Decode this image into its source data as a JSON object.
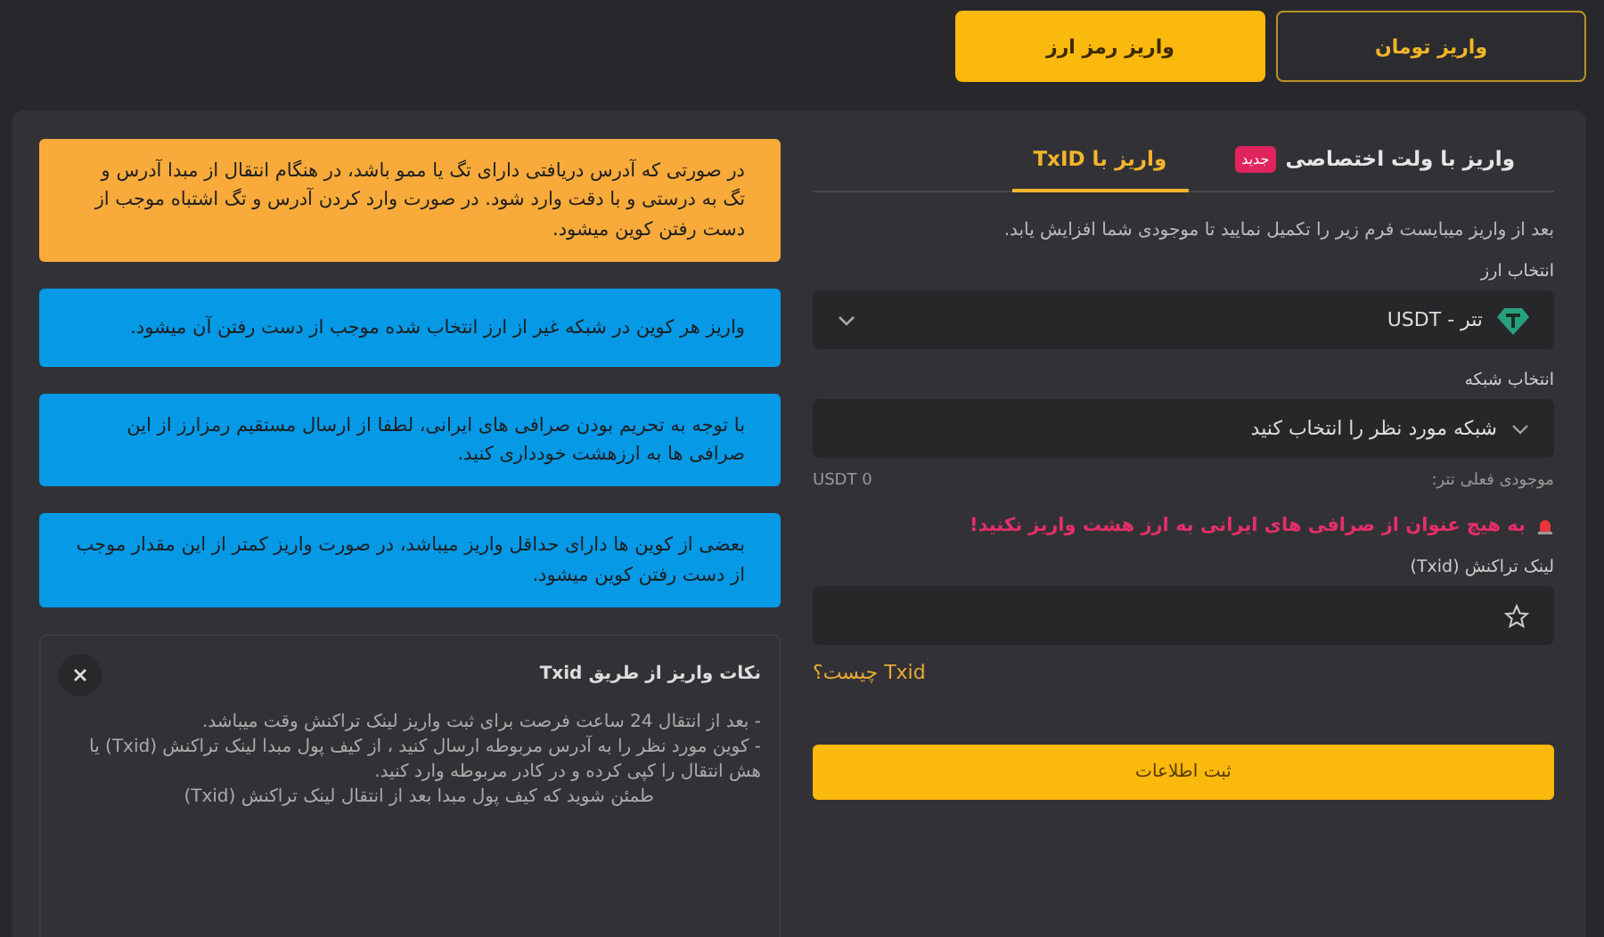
{
  "top_tabs": [
    {
      "label": "واریز تومان",
      "selected": false
    },
    {
      "label": "واریز رمز ارز",
      "selected": true
    }
  ],
  "form": {
    "tabs": [
      {
        "label": "واریز با ولت اختصاصی",
        "badge": "جدید",
        "selected": false
      },
      {
        "label": "واریز با TxID",
        "selected": true
      }
    ],
    "intro": "بعد از واریز میبایست فرم زیر را تکمیل نمایید تا موجودی شما افزایش یابد.",
    "currency": {
      "label": "انتخاب ارز",
      "value": "تتر - USDT"
    },
    "network": {
      "label": "انتخاب شبکه",
      "placeholder": "شبکه مورد نظر را انتخاب کنید"
    },
    "balance": {
      "label": "موجودی فعلی تتر:",
      "value": "USDT 0"
    },
    "warning": "به هیچ عنوان از صرافی های ایرانی به ارز هشت واریز نکنید!",
    "txid": {
      "label": "لینک تراکنش (Txid)"
    },
    "help_link": "Txid چیست؟",
    "submit": "ثبت اطلاعات"
  },
  "notices": [
    {
      "kind": "warning",
      "text": "در صورتی که آدرس دریافتی دارای تگ یا ممو باشد، در هنگام انتقال از مبدا آدرس و تگ به درستی و با دقت وارد شود. در صورت وارد کردن آدرس و تگ اشتباه موجب از دست رفتن کوین میشود."
    },
    {
      "kind": "info",
      "text": "واریز هر کوین در شبکه غیر از ارز انتخاب شده موجب از دست رفتن آن میشود."
    },
    {
      "kind": "info",
      "text": "با توجه به تحریم بودن صرافی های ایرانی، لطفا از ارسال مستقیم رمزارز از این صرافی ها به ارزهشت خودداری کنید."
    },
    {
      "kind": "info",
      "text": "بعضی از کوین ها دارای حداقل واریز میباشد، در صورت واریز کمتر از این مقدار موجب از دست رفتن کوین میشود."
    }
  ],
  "tips": {
    "title": "نکات واریز از طریق Txid",
    "lines": [
      "- بعد از انتقال 24 ساعت فرصت برای ثبت واریز لینک تراکنش وقت میباشد.",
      "- کوین مورد نظر را به آدرس مربوطه ارسال کنید ، از کیف پول مبدا لینک تراکنش (Txid) یا هش انتقال را کپی کرده و در کادر مربوطه وارد کنید.",
      "طمئن شوید که کیف پول مبدا بعد از انتقال لینک تراکنش (Txid)"
    ]
  }
}
